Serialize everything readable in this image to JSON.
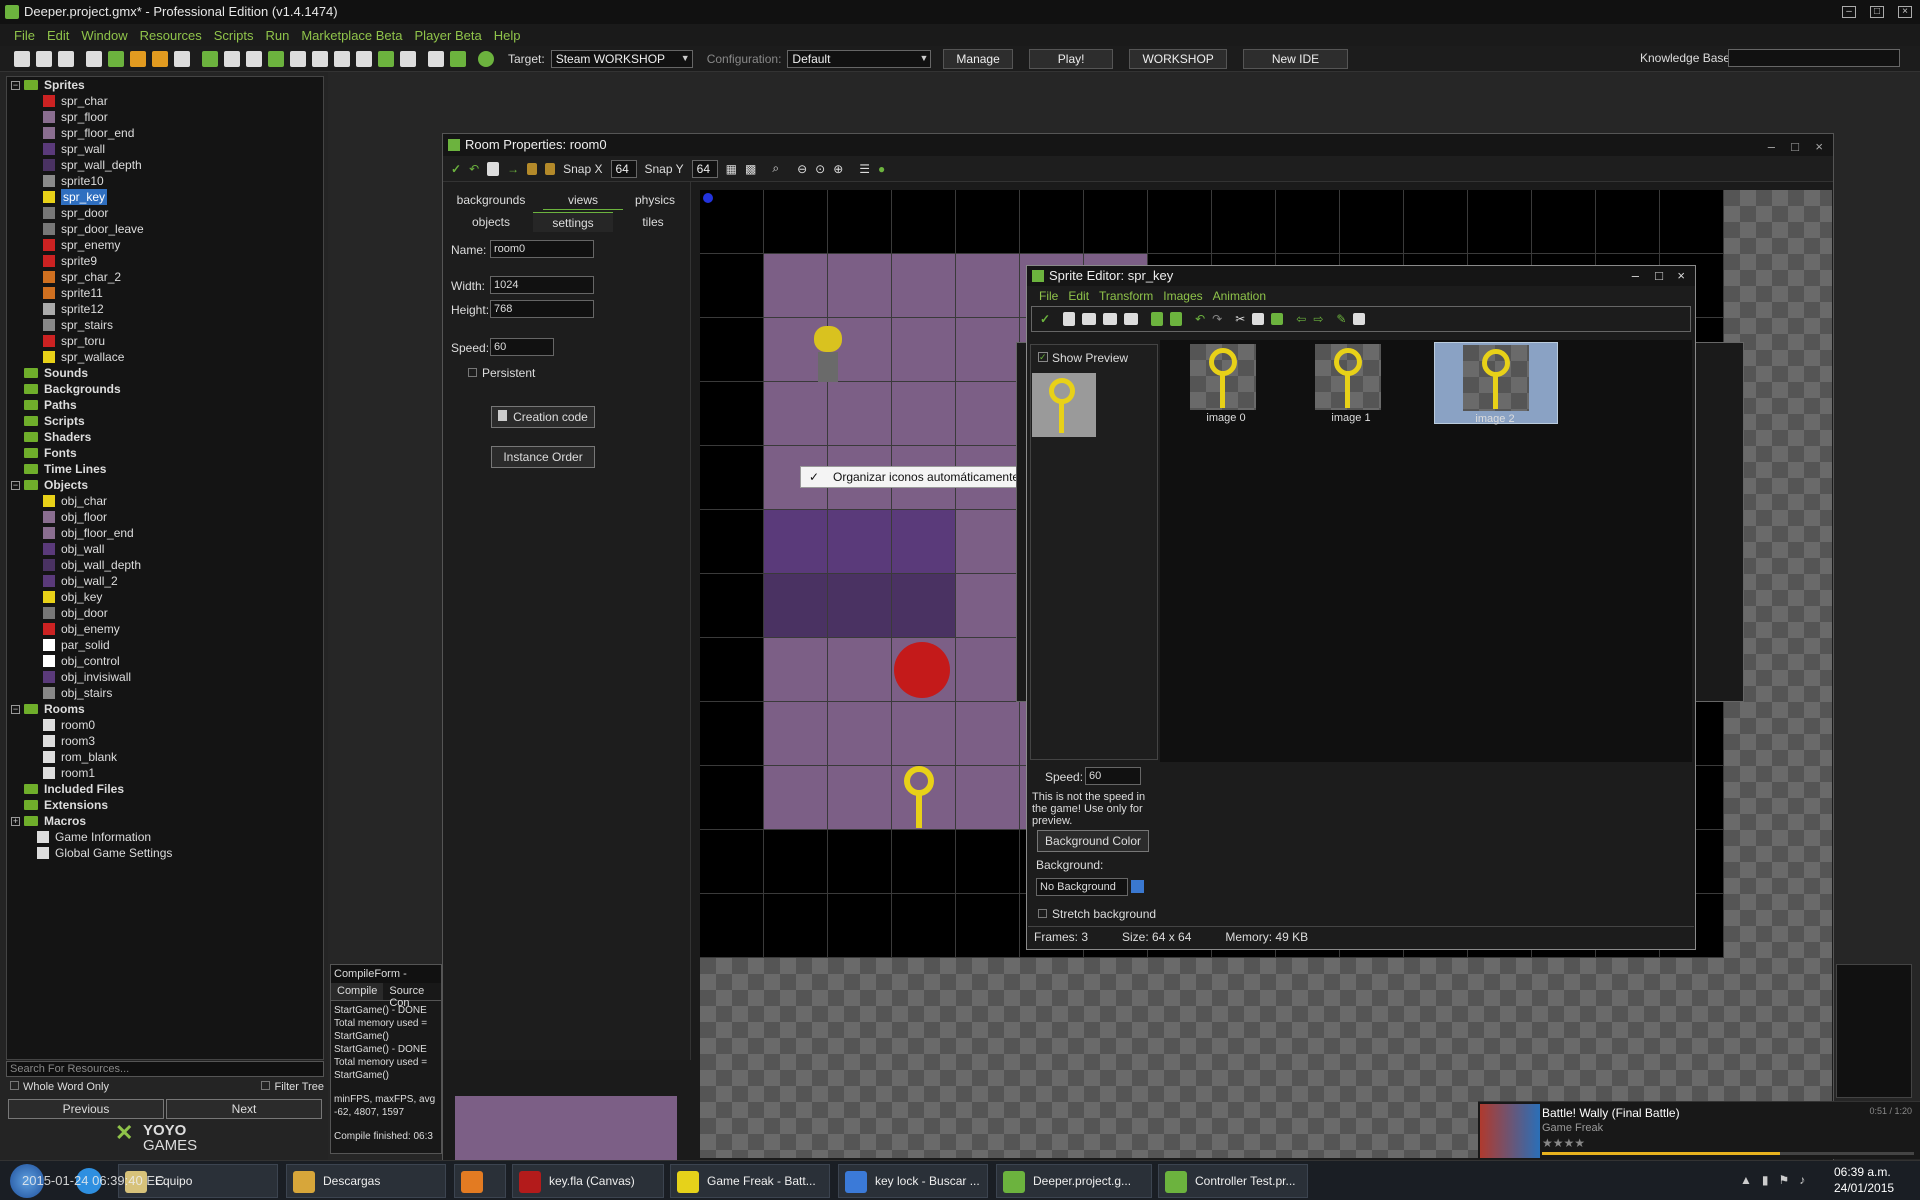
{
  "window": {
    "title": "Deeper.project.gmx* - Professional Edition (v1.4.1474)"
  },
  "menu": [
    "File",
    "Edit",
    "Window",
    "Resources",
    "Scripts",
    "Run",
    "Marketplace Beta",
    "Player Beta",
    "Help"
  ],
  "toolbar": {
    "target_label": "Target:",
    "target_value": "Steam WORKSHOP",
    "config_label": "Configuration:",
    "config_value": "Default",
    "manage": "Manage",
    "play": "Play!",
    "workshop": "WORKSHOP",
    "new_ide": "New IDE",
    "kb_label": "Knowledge Base:"
  },
  "tree": {
    "sprites_label": "Sprites",
    "sprites": [
      "spr_char",
      "spr_floor",
      "spr_floor_end",
      "spr_wall",
      "spr_wall_depth",
      "sprite10",
      "spr_key",
      "spr_door",
      "spr_door_leave",
      "spr_enemy",
      "sprite9",
      "spr_char_2",
      "sprite11",
      "sprite12",
      "spr_stairs",
      "spr_toru",
      "spr_wallace"
    ],
    "groups_mid": [
      "Sounds",
      "Backgrounds",
      "Paths",
      "Scripts",
      "Shaders",
      "Fonts",
      "Time Lines"
    ],
    "objects_label": "Objects",
    "objects": [
      "obj_char",
      "obj_floor",
      "obj_floor_end",
      "obj_wall",
      "obj_wall_depth",
      "obj_wall_2",
      "obj_key",
      "obj_door",
      "obj_enemy",
      "par_solid",
      "obj_control",
      "obj_invisiwall",
      "obj_stairs"
    ],
    "rooms_label": "Rooms",
    "rooms": [
      "room0",
      "room3",
      "rom_blank",
      "room1"
    ],
    "groups_end": [
      "Included Files",
      "Extensions",
      "Macros"
    ],
    "leaves_end": [
      "Game Information",
      "Global Game Settings"
    ],
    "search_placeholder": "Search For Resources...",
    "whole_word": "Whole Word Only",
    "filter_tree": "Filter Tree",
    "prev": "Previous",
    "next": "Next",
    "logo_line1": "YOYO",
    "logo_line2": "GAMES"
  },
  "room": {
    "title": "Room Properties: room0",
    "snapx_label": "Snap X",
    "snapx": "64",
    "snapy_label": "Snap Y",
    "snapy": "64",
    "tabs_row1": [
      "backgrounds",
      "views",
      "physics"
    ],
    "tabs_row2": [
      "objects",
      "settings",
      "tiles"
    ],
    "name_label": "Name:",
    "name": "room0",
    "width_label": "Width:",
    "width": "1024",
    "height_label": "Height:",
    "height": "768",
    "speed_label": "Speed:",
    "speed": "60",
    "persistent": "Persistent",
    "creation_code": "Creation code",
    "instance_order": "Instance Order"
  },
  "context_menu": {
    "item": "Organizar iconos automáticamente"
  },
  "sprite_editor": {
    "title": "Sprite Editor: spr_key",
    "menu": [
      "File",
      "Edit",
      "Transform",
      "Images",
      "Animation"
    ],
    "show_preview": "Show Preview",
    "frames": [
      "image 0",
      "image 1",
      "image 2"
    ],
    "speed_label": "Speed:",
    "speed": "60",
    "note": "This is not the speed in the game! Use only for preview.",
    "bg_color_btn": "Background Color",
    "background_label": "Background:",
    "background_value": "No Background",
    "stretch": "Stretch background",
    "status_frames": "Frames: 3",
    "status_size": "Size: 64 x 64",
    "status_memory": "Memory: 49 KB"
  },
  "compile": {
    "title": "CompileForm - Compile",
    "tabs": [
      "Compile",
      "Source Con"
    ],
    "lines": [
      "StartGame() - DONE",
      "Total memory used =",
      "StartGame()",
      "StartGame() - DONE",
      "Total memory used =",
      "StartGame()",
      "",
      "minFPS, maxFPS, avg",
      "-62, 4807, 1597",
      "",
      "Compile finished: 06:3"
    ]
  },
  "taskbar": {
    "tasks": [
      "Equipo",
      "Descargas",
      "",
      "key.fla (Canvas)",
      "Game Freak - Batt...",
      "key lock - Buscar ...",
      "Deeper.project.g...",
      "Controller Test.pr..."
    ],
    "clock_time": "06:39 a.m.",
    "clock_date": "24/01/2015",
    "overlay_text": "2015-01-24 06:39:40 EC"
  },
  "music": {
    "title": "Battle! Wally (Final Battle)",
    "artist": "Game Freak",
    "time": "0:51 / 1:20"
  },
  "colors": {
    "accent_green": "#8fc34a",
    "selection": "#2f6fc0",
    "floor": "#7c5f86",
    "wall": "#5a3a7a"
  }
}
